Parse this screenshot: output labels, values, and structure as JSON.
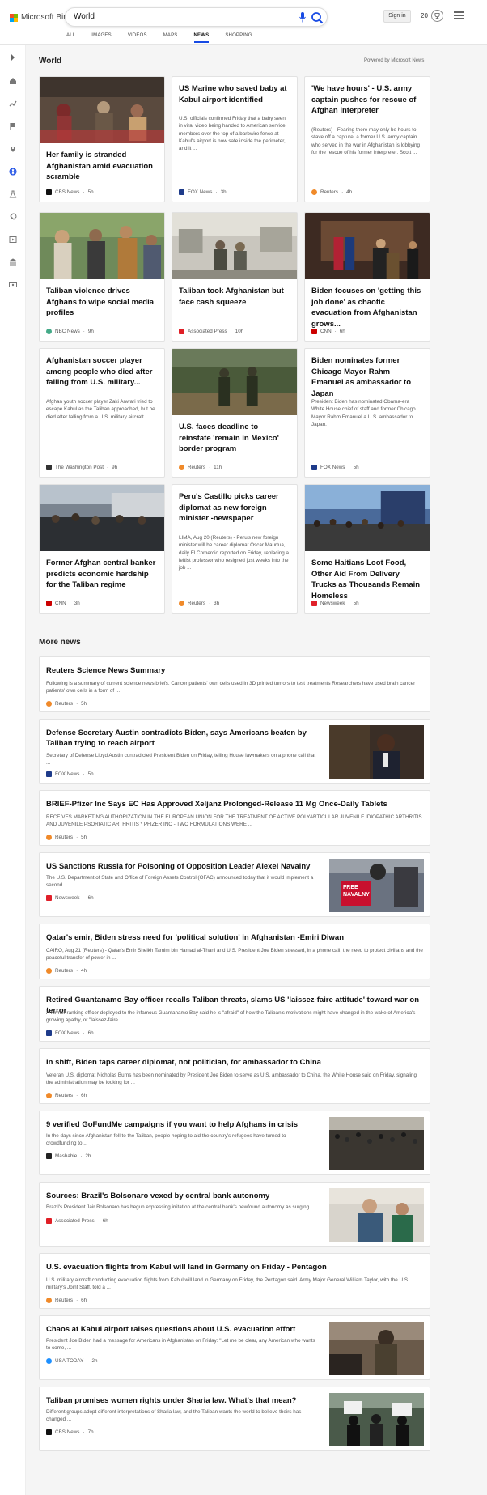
{
  "header": {
    "brand": "Microsoft Bing",
    "search_value": "World",
    "signin_label": "Sign in",
    "points": "20"
  },
  "tabs": [
    {
      "label": "ALL"
    },
    {
      "label": "IMAGES"
    },
    {
      "label": "VIDEOS"
    },
    {
      "label": "MAPS"
    },
    {
      "label": "NEWS",
      "active": true
    },
    {
      "label": "SHOPPING"
    }
  ],
  "section": {
    "title": "World",
    "powered": "Powered by Microsoft News",
    "more_title": "More news"
  },
  "colors": {
    "accent": "#174ae4",
    "background": "#f5f5f5"
  },
  "cards": [
    {
      "title": "Her family is stranded Afghanistan amid evacuation scramble",
      "snippet": "",
      "source": "CBS News",
      "time": "5h"
    },
    {
      "title": "US Marine who saved baby at Kabul airport identified",
      "snippet": "U.S. officials confirmed Friday that a baby seen in viral video being handed to American service members over the top of a barbwire fence at Kabul's airport is now safe inside the perimeter, and it ...",
      "source": "FOX News",
      "time": "3h"
    },
    {
      "title": "'We have hours' - U.S. army captain pushes for rescue of Afghan interpreter",
      "snippet": "(Reuters) - Fearing there may only be hours to stave off a capture, a former U.S. army captain who served in the war in Afghanistan is lobbying for the rescue of his former interpreter.     Scott ...",
      "source": "Reuters",
      "time": "4h"
    },
    {
      "title": "Taliban violence drives Afghans to wipe social media profiles",
      "snippet": "",
      "source": "NBC News",
      "time": "9h"
    },
    {
      "title": "Taliban took Afghanistan but face cash squeeze",
      "snippet": "",
      "source": "Associated Press",
      "time": "10h"
    },
    {
      "title": "Biden focuses on 'getting this job done' as chaotic evacuation from Afghanistan grows...",
      "snippet": "",
      "source": "CNN",
      "time": "6h"
    },
    {
      "title": "Afghanistan soccer player among people who died after falling from U.S. military...",
      "snippet": "Afghan youth soccer player Zaki Anwari tried to escape Kabul as the Taliban approached, but he died after falling from a U.S. military aircraft.",
      "source": "The Washington Post",
      "time": "9h"
    },
    {
      "title": "U.S. faces deadline to reinstate 'remain in Mexico' border program",
      "snippet": "",
      "source": "Reuters",
      "time": "11h"
    },
    {
      "title": "Biden nominates former Chicago Mayor Rahm Emanuel as ambassador to Japan",
      "snippet": "President Biden has nominated Obama-era White House chief of staff and former Chicago Mayor Rahm Emanuel a U.S. ambassador to Japan.",
      "source": "FOX News",
      "time": "5h"
    },
    {
      "title": "Former Afghan central banker predicts economic hardship for the Taliban regime",
      "snippet": "",
      "source": "CNN",
      "time": "3h"
    },
    {
      "title": "Peru's Castillo picks career diplomat as new foreign minister -newspaper",
      "snippet": "LIMA, Aug 20 (Reuters) - Peru's new foreign minister will be career diplomat Oscar Maurtua, daily El Comercio reported on Friday, replacing a leftist professor who resigned just weeks into the job ...",
      "source": "Reuters",
      "time": "3h"
    },
    {
      "title": "Some Haitians Loot Food, Other Aid From Delivery Trucks as Thousands Remain Homeless",
      "snippet": "",
      "source": "Newsweek",
      "time": "5h"
    }
  ],
  "more_news": [
    {
      "title": "Reuters Science News Summary",
      "snippet": "Following is a summary of current science news briefs. Cancer patients' own cells used in 3D printed tumors to test treatments Researchers have used brain cancer patients' own cells in a form of ...",
      "source": "Reuters",
      "time": "5h"
    },
    {
      "title": "Defense Secretary Austin contradicts Biden, says Americans beaten by Taliban trying to reach airport",
      "snippet": "Secretary of Defense Lloyd Austin contradicted President Biden on Friday, telling House lawmakers on a phone call that ...",
      "source": "FOX News",
      "time": "5h"
    },
    {
      "title": "BRIEF-Pfizer Inc Says EC Has Approved Xeljanz Prolonged-Release 11 Mg Once-Daily Tablets",
      "snippet": "RECEIVES MARKETING AUTHORIZATION IN THE EUROPEAN UNION FOR THE TREATMENT OF ACTIVE POLYARTICULAR JUVENILE IDIOPATHIC ARTHRITIS AND JUVENILE PSORIATIC ARTHRITIS * PFIZER INC - TWO FORMULATIONS WERE ...",
      "source": "Reuters",
      "time": "5h"
    },
    {
      "title": "US Sanctions Russia for Poisoning of Opposition Leader Alexei Navalny",
      "snippet": "The U.S. Department of State and Office of Foreign Assets Control (OFAC) announced today that it would implement a second ...",
      "source": "Newsweek",
      "time": "6h",
      "img_text": "FREE NAVALNY"
    },
    {
      "title": "Qatar's emir, Biden stress need for 'political solution' in Afghanistan -Emiri Diwan",
      "snippet": "CAIRO, Aug 21 (Reuters) - Qatar's Emir Sheikh Tamim bin Hamad al-Thani and U.S. President Joe Biden stressed, in a phone call, the need to protect civilians and the peaceful transfer of power in ...",
      "source": "Reuters",
      "time": "4h"
    },
    {
      "title": "Retired Guantanamo Bay officer recalls Taliban threats, slams US 'laissez-faire attitude' toward war on terror",
      "snippet": "A former ranking officer deployed to the infamous Guantanamo Bay said he is \"afraid\" of how the Taliban's motivations might have changed in the wake of America's growing apathy, or \"laissez-faire ...",
      "source": "FOX News",
      "time": "6h"
    },
    {
      "title": "In shift, Biden taps career diplomat, not politician, for ambassador to China",
      "snippet": "Veteran U.S. diplomat Nicholas Burns has been nominated by President Joe Biden to serve as U.S. ambassador to China, the White House said on Friday, signaling the administration may be looking for ...",
      "source": "Reuters",
      "time": "6h"
    },
    {
      "title": "9 verified GoFundMe campaigns if you want to help Afghans in crisis",
      "snippet": "In the days since Afghanistan fell to the Taliban, people hoping to aid the country's refugees have turned to crowdfunding to ...",
      "source": "Mashable",
      "time": "2h"
    },
    {
      "title": "Sources: Brazil's Bolsonaro vexed by central bank autonomy",
      "snippet": "Brazil's President Jair Bolsonaro has begun expressing irritation at the central bank's newfound autonomy as surging ...",
      "source": "Associated Press",
      "time": "6h"
    },
    {
      "title": "U.S. evacuation flights from Kabul will land in Germany on Friday - Pentagon",
      "snippet": "U.S. military aircraft conducting evacuation flights from Kabul will land in Germany on Friday, the Pentagon said. Army Major General William Taylor, with the U.S. military's Joint Staff, told a ...",
      "source": "Reuters",
      "time": "6h"
    },
    {
      "title": "Chaos at Kabul airport raises questions about U.S. evacuation effort",
      "snippet": "President Joe Biden had a message for Americans in Afghanistan on Friday: \"Let me be clear, any American who wants to come, ...",
      "source": "USA TODAY",
      "time": "2h"
    },
    {
      "title": "Taliban promises women rights under Sharia law. What's that mean?",
      "snippet": "Different groups adopt different interpretations of Sharia law, and the Taliban wants the world to believe theirs has changed ...",
      "source": "CBS News",
      "time": "7h"
    }
  ]
}
